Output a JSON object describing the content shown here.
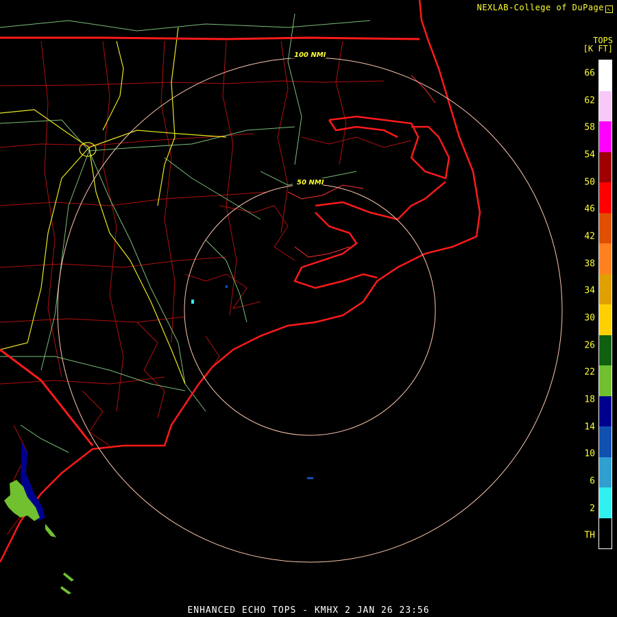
{
  "credit": "NEXLAB-College of DuPage",
  "legend": {
    "title_line1": "TOPS",
    "title_line2": "[K FT]",
    "labels": [
      "66",
      "62",
      "58",
      "54",
      "50",
      "46",
      "42",
      "38",
      "34",
      "30",
      "26",
      "22",
      "18",
      "14",
      "10",
      "6",
      "2",
      "TH"
    ],
    "colors": [
      "#ffffff",
      "#f8c8f8",
      "#ff00ff",
      "#a00000",
      "#ff0000",
      "#e05000",
      "#ff8020",
      "#e0a000",
      "#ffd000",
      "#106010",
      "#70c030",
      "#000090",
      "#1050b0",
      "#30a0d0",
      "#30f0f0",
      "#000000"
    ]
  },
  "rings": {
    "inner_label": "50 NMI",
    "outer_label": "100 NMI"
  },
  "footer": "ENHANCED ECHO TOPS - KMHX 2 JAN 26 23:56"
}
